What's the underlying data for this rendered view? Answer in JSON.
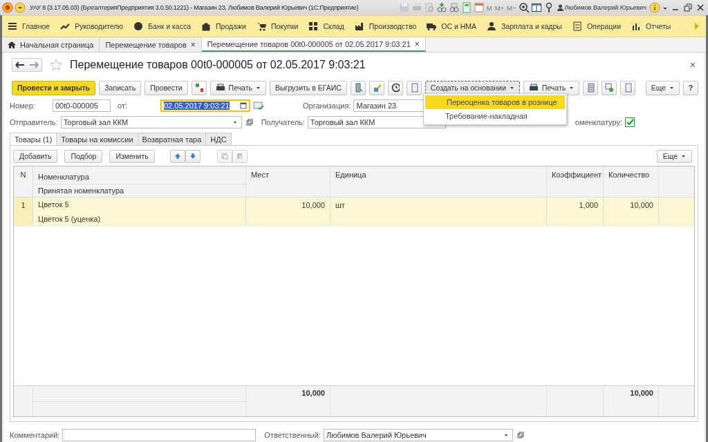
{
  "window": {
    "title": "УАУ 8 (3.17.05.03) (БухгалтерияПредприятия 3.0.50.1221) - Магазин 23, Любимов Валерий Юрьевич  (1С:Предприятие)",
    "memory_buttons": [
      "M",
      "M+",
      "M−"
    ],
    "user": "Любимов Валерий Юрьевич"
  },
  "sections": [
    {
      "label": "Главное"
    },
    {
      "label": "Руководителю"
    },
    {
      "label": "Банк и касса"
    },
    {
      "label": "Продажи"
    },
    {
      "label": "Покупки"
    },
    {
      "label": "Склад"
    },
    {
      "label": "Производство"
    },
    {
      "label": "ОС и НМА"
    },
    {
      "label": "Зарплата и кадры"
    },
    {
      "label": "Операции"
    },
    {
      "label": "Отчеты"
    }
  ],
  "open_tabs": [
    {
      "label": "Начальная страница",
      "selected": false
    },
    {
      "label": "Перемещение товаров",
      "close": "×",
      "selected": false
    },
    {
      "label": "Перемещение товаров 00t0-000005 от 02.05.2017 9:03:21",
      "close": "×",
      "selected": true
    }
  ],
  "form": {
    "title": "Перемещение товаров 00t0-000005 от 02.05.2017 9:03:21",
    "close": "×",
    "toolbar": [
      {
        "kind": "primary",
        "label": "Провести и закрыть"
      },
      {
        "kind": "text",
        "label": "Записать"
      },
      {
        "kind": "text",
        "label": "Провести"
      },
      {
        "kind": "icon"
      },
      {
        "kind": "dropdown",
        "label": "Печать"
      },
      {
        "kind": "text",
        "label": "Выгрузить в ЕГАИС"
      },
      {
        "kind": "icon"
      },
      {
        "kind": "icon"
      },
      {
        "kind": "icon"
      },
      {
        "kind": "icon"
      },
      {
        "kind": "dropdown",
        "label": "Создать на основании",
        "expanded": true
      },
      {
        "kind": "dropdown",
        "label": "Печать"
      },
      {
        "kind": "icon"
      },
      {
        "kind": "icon"
      },
      {
        "kind": "icon"
      },
      {
        "kind": "more",
        "label": "Еще"
      },
      {
        "kind": "help",
        "label": "?"
      }
    ],
    "menu": [
      {
        "label": "Переоценка товаров в рознице",
        "selected": true
      },
      {
        "label": "Требование-накладная",
        "selected": false
      }
    ],
    "number": {
      "label": "Номер:",
      "value": "00t0-000005"
    },
    "date": {
      "label": "от:",
      "value": "02.05.2017  9:03:21"
    },
    "organization": {
      "label": "Организация:",
      "value": "Магазин 23"
    },
    "sender": {
      "label": "Отправитель:",
      "value": "Торговый зал ККМ"
    },
    "receiver": {
      "label": "Получатель:",
      "value": "Торговый зал ККМ"
    },
    "nomenclature_check": {
      "label": "оменклатуру:",
      "checked": true
    },
    "tabs": [
      {
        "label": "Товары (1)",
        "selected": true
      },
      {
        "label": "Товары на комиссии",
        "selected": false
      },
      {
        "label": "Возвратная тара",
        "selected": false
      },
      {
        "label": "НДС",
        "selected": false
      }
    ],
    "table_toolbar": {
      "buttons": [
        "Добавить",
        "Подбор",
        "Изменить"
      ],
      "more": "Еще"
    },
    "table": {
      "columns": [
        "N",
        "Номенклатура",
        "Мест",
        "Единица",
        "Коэффициент",
        "Количество"
      ],
      "subcolumn": "Принятая номенклатура",
      "rows": [
        {
          "n": "1",
          "item": "Цветок 5",
          "accepted": "Цветок 5 (уценка)",
          "places": "10,000",
          "unit": "шт",
          "coefficient": "1,000",
          "quantity": "10,000",
          "selected": true
        }
      ],
      "totals": {
        "places": "10,000",
        "quantity": "10,000"
      }
    },
    "comment": {
      "label": "Комментарий:"
    },
    "responsible": {
      "label": "Ответственный:",
      "value": "Любимов Валерий Юрьевич"
    }
  }
}
